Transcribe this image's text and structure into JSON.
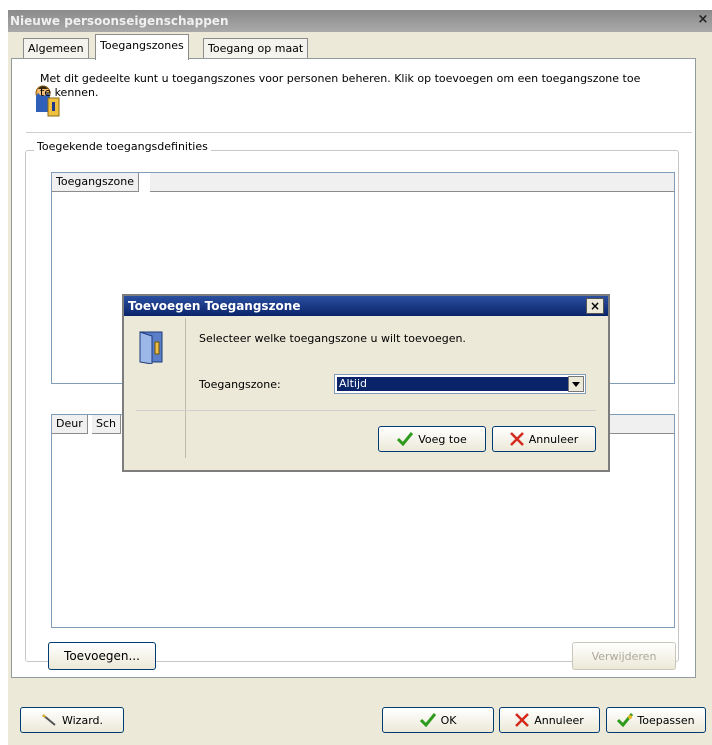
{
  "window": {
    "title": "Nieuwe persoonseigenschappen",
    "close_glyph": "×"
  },
  "tabs": [
    {
      "label": "Algemeen"
    },
    {
      "label": "Toegangszones",
      "active": true
    },
    {
      "label": "Toegang op maat"
    }
  ],
  "intro": {
    "text": "Met dit gedeelte kunt u toegangszones voor personen beheren. Klik op toevoegen om een toegangszone toe te kennen.",
    "icon": "person-key-icon"
  },
  "group": {
    "label": "Toegekende toegangsdefinities"
  },
  "zones_list": {
    "columns": [
      "Toegangszone"
    ]
  },
  "doors_list": {
    "columns": [
      "Deur",
      "Sch"
    ]
  },
  "panel_buttons": {
    "add": "Toevoegen...",
    "remove": "Verwijderen"
  },
  "footer_buttons": {
    "wizard": "Wizard.",
    "ok": "OK",
    "cancel": "Annuleer",
    "apply": "Toepassen"
  },
  "dialog": {
    "title": "Toevoegen Toegangszone",
    "close_glyph": "×",
    "prompt": "Selecteer welke toegangszone u wilt toevoegen.",
    "field_label": "Toegangszone:",
    "selected_value": "Altijd",
    "buttons": {
      "add": "Voeg toe",
      "cancel": "Annuleer"
    },
    "icon": "door-icon"
  },
  "colors": {
    "title_active": "#0a246a",
    "title_inactive": "#9a9a9a",
    "face": "#ece9d8",
    "check_green": "#2e9a1e",
    "cross_red": "#d42a1e"
  }
}
